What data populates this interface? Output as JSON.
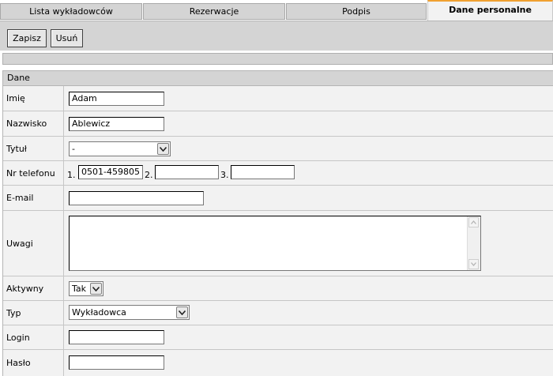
{
  "tabs": [
    {
      "label": "Lista wykładowców",
      "active": false
    },
    {
      "label": "Rezerwacje",
      "active": false
    },
    {
      "label": "Podpis",
      "active": false
    },
    {
      "label": "Dane personalne",
      "active": true
    }
  ],
  "toolbar": {
    "save_label": "Zapisz",
    "delete_label": "Usuń"
  },
  "form": {
    "section_title": "Dane",
    "first_name": {
      "label": "Imię",
      "value": "Adam"
    },
    "last_name": {
      "label": "Nazwisko",
      "value": "Ablewicz"
    },
    "title": {
      "label": "Tytuł",
      "value": "-"
    },
    "phone": {
      "label": "Nr telefonu",
      "nums": [
        "1.",
        "2.",
        "3."
      ],
      "values": [
        "0501-459805",
        "",
        ""
      ]
    },
    "email": {
      "label": "E-mail",
      "value": ""
    },
    "notes": {
      "label": "Uwagi",
      "value": ""
    },
    "active": {
      "label": "Aktywny",
      "value": "Tak"
    },
    "type": {
      "label": "Typ",
      "value": "Wykładowca"
    },
    "login": {
      "label": "Login",
      "value": ""
    },
    "password": {
      "label": "Hasło",
      "value": ""
    }
  },
  "colors": {
    "active_tab_accent": "#f0a030",
    "panel_gray": "#d4d4d4",
    "row_bg": "#f2f2f2"
  }
}
